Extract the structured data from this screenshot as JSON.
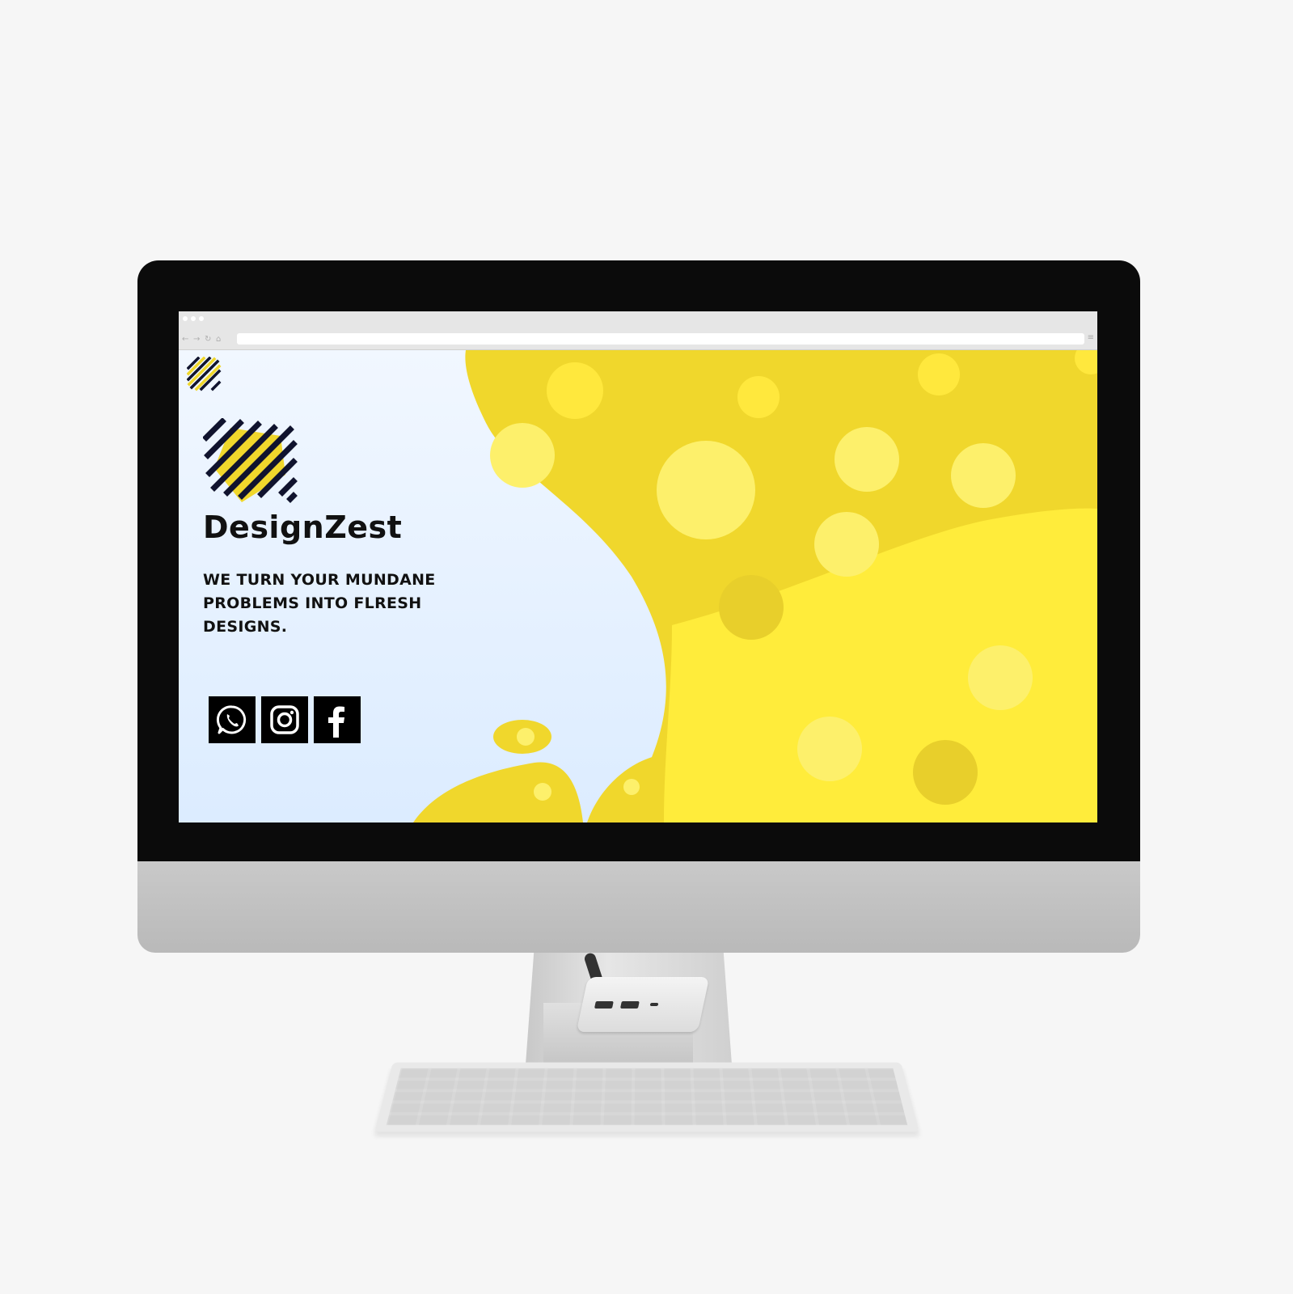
{
  "browser": {
    "nav_icons": [
      "back-icon",
      "forward-icon",
      "reload-icon",
      "home-icon"
    ],
    "back_glyph": "←",
    "forward_glyph": "→",
    "reload_glyph": "↻",
    "home_glyph": "⌂",
    "menu_glyph": "≡",
    "url": ""
  },
  "site": {
    "brand_name": "DesignZest",
    "tagline": "WE TURN YOUR MUNDANE PROBLEMS INTO FLRESH DESIGNS.",
    "social": [
      {
        "icon": "whatsapp-icon"
      },
      {
        "icon": "instagram-icon"
      },
      {
        "icon": "facebook-icon"
      }
    ]
  },
  "colors": {
    "accent_yellow": "#f2d92a",
    "bright_yellow": "#ffec3b",
    "light_bg": "#e9f3ff",
    "logo_navy": "#10132e"
  }
}
